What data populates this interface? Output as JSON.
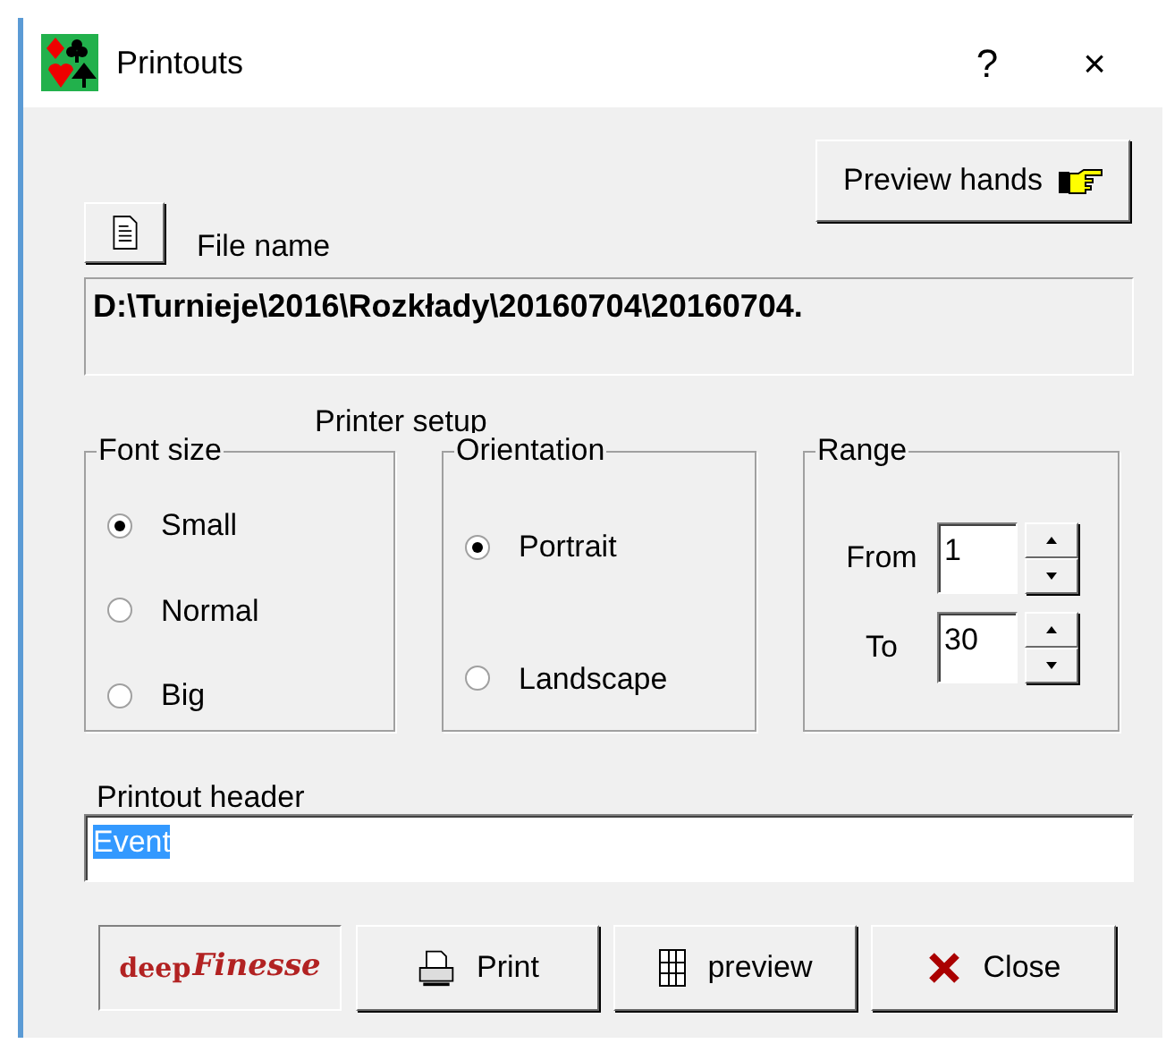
{
  "window": {
    "title": "Printouts",
    "help": "?",
    "close": "×"
  },
  "file": {
    "label": "File name",
    "path": "D:\\Turnieje\\2016\\Rozkłady\\20160704\\20160704."
  },
  "preview_hands": {
    "label": "Preview hands"
  },
  "printer_setup": {
    "title": "Printer setup",
    "font_size": {
      "title": "Font size",
      "options": [
        {
          "label": "Small",
          "selected": true
        },
        {
          "label": "Normal",
          "selected": false
        },
        {
          "label": "Big",
          "selected": false
        }
      ]
    },
    "orientation": {
      "title": "Orientation",
      "options": [
        {
          "label": "Portrait",
          "selected": true
        },
        {
          "label": "Landscape",
          "selected": false
        }
      ]
    },
    "range": {
      "title": "Range",
      "fields": [
        {
          "label": "From",
          "value": "1"
        },
        {
          "label": "To",
          "value": "30"
        }
      ]
    }
  },
  "header": {
    "label": "Printout header",
    "value": "Event",
    "text_selected": true
  },
  "buttons": [
    {
      "kind": "logo",
      "parts": [
        "deep",
        "Finesse"
      ]
    },
    {
      "kind": "print",
      "label": "Print"
    },
    {
      "kind": "grid",
      "label": "preview"
    },
    {
      "kind": "close",
      "label": "Close"
    }
  ]
}
